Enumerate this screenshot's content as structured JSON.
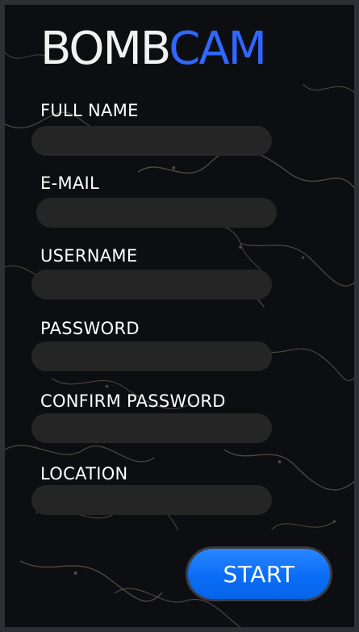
{
  "app": {
    "logo_part1": "BOMB",
    "logo_part2": "CAM"
  },
  "form": {
    "fields": [
      {
        "label": "FULL NAME",
        "value": "",
        "placeholder": ""
      },
      {
        "label": "E-MAIL",
        "value": "",
        "placeholder": ""
      },
      {
        "label": "USERNAME",
        "value": "",
        "placeholder": ""
      },
      {
        "label": "PASSWORD",
        "value": "",
        "placeholder": ""
      },
      {
        "label": "CONFIRM PASSWORD",
        "value": "",
        "placeholder": ""
      },
      {
        "label": "LOCATION",
        "value": "",
        "placeholder": ""
      }
    ],
    "submit_label": "START"
  },
  "colors": {
    "accent": "#2f67ff",
    "button": "#0a6df5",
    "background": "#0d0e12",
    "field": "#252526"
  }
}
